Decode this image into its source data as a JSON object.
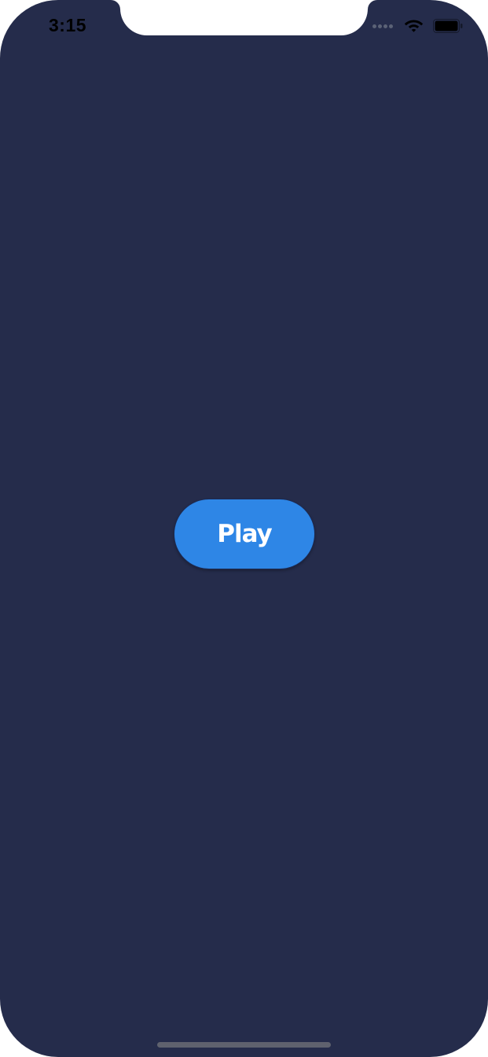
{
  "status_bar": {
    "time": "3:15",
    "signal_icon": "cellular-signal-icon",
    "wifi_icon": "wifi-icon",
    "battery_icon": "battery-icon"
  },
  "main": {
    "play_label": "Play"
  },
  "colors": {
    "background": "#252c4b",
    "play_button": "#2e86e6",
    "play_text": "#ffffff",
    "status_text": "#000000",
    "home_indicator": "#5f626e"
  }
}
